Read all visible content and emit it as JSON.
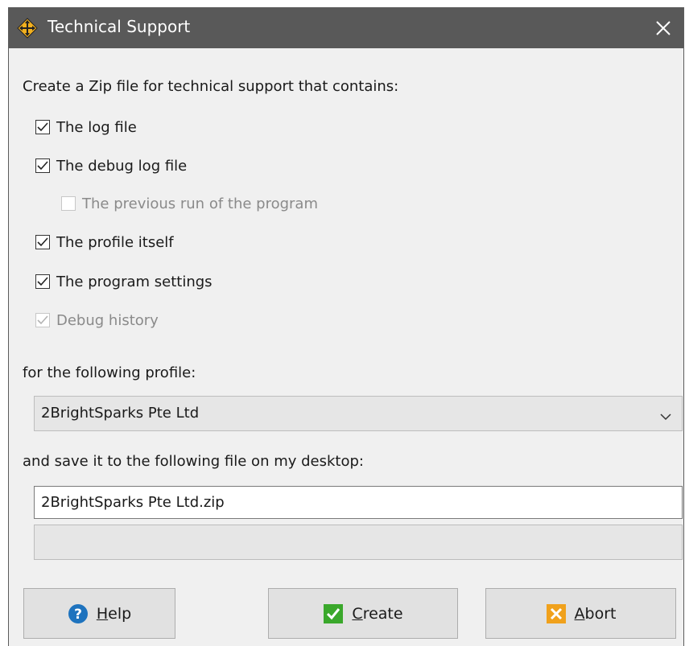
{
  "window": {
    "title": "Technical Support",
    "app_icon": "move-cross-icon",
    "close_icon": "close-icon"
  },
  "intro_label": "Create a Zip file for technical support that contains:",
  "options": [
    {
      "label": "The log file",
      "checked": true,
      "enabled": true
    },
    {
      "label": "The debug log file",
      "checked": true,
      "enabled": true
    },
    {
      "label": "The previous run of the program",
      "checked": false,
      "enabled": false
    },
    {
      "label": "The profile itself",
      "checked": true,
      "enabled": true
    },
    {
      "label": "The program settings",
      "checked": true,
      "enabled": true
    },
    {
      "label": "Debug history",
      "checked": true,
      "enabled": false
    }
  ],
  "profile_label": "for the following profile:",
  "profile_select": {
    "value": "2BrightSparks Pte Ltd"
  },
  "save_label": "and save it to the following file on my desktop:",
  "filename_input": {
    "value": "2BrightSparks Pte Ltd.zip"
  },
  "buttons": {
    "help": {
      "mnemonic": "H",
      "rest": "elp",
      "icon": "help-icon"
    },
    "create": {
      "mnemonic": "C",
      "rest": "reate",
      "icon": "checkmark-icon"
    },
    "abort": {
      "mnemonic": "A",
      "rest": "bort",
      "icon": "abort-icon"
    }
  },
  "colors": {
    "titlebar": "#595959",
    "help_icon": "#1e73be",
    "create_icon": "#3aa82b",
    "abort_icon": "#f0a11c"
  }
}
